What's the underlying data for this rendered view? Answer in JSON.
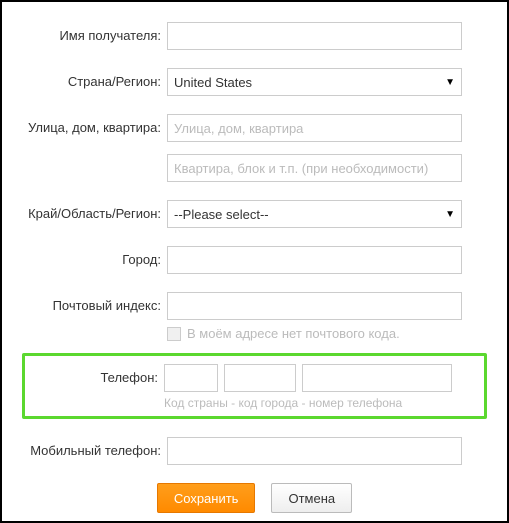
{
  "labels": {
    "recipientName": "Имя получателя:",
    "countryRegion": "Страна/Регион:",
    "street": "Улица, дом, квартира:",
    "region": "Край/Область/Регион:",
    "city": "Город:",
    "postalCode": "Почтовый индекс:",
    "phone": "Телефон:",
    "mobilePhone": "Мобильный телефон:"
  },
  "values": {
    "country": "United States",
    "regionSelected": "--Please select--"
  },
  "placeholders": {
    "street": "Улица, дом, квартира",
    "street2": "Квартира, блок и т.п. (при необходимости)"
  },
  "hints": {
    "noPostal": "В моём адресе нет почтового кода.",
    "phoneFormat": "Код страны - код города - номер телефона"
  },
  "buttons": {
    "save": "Сохранить",
    "cancel": "Отмена"
  }
}
